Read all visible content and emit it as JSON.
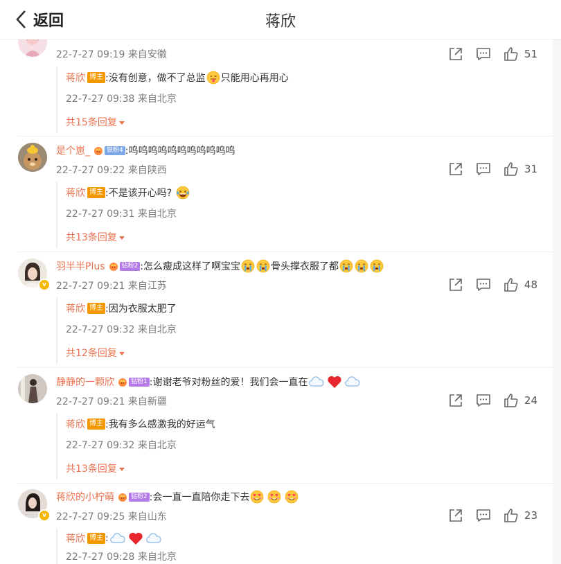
{
  "header": {
    "back_label": "返回",
    "title": "蒋欣"
  },
  "comments": [
    {
      "username": "",
      "text": "",
      "date": "22-7-27 09:19",
      "location": "来自安徽",
      "likes": "51",
      "reply": {
        "author": "蒋欣",
        "badge": "博主",
        "text_before": ":没有创意，做不了总监",
        "emoji": "tongue-face-icon",
        "text_after": "只能用心再用心",
        "date": "22-7-27 09:38",
        "location": "来自北京"
      },
      "more_replies": "共15条回复"
    },
    {
      "username": "是个崽_",
      "fan_badge": "铁粉4",
      "text": ":呜呜呜呜呜呜呜呜呜呜呜",
      "date": "22-7-27 09:22",
      "location": "来自陕西",
      "likes": "31",
      "reply": {
        "author": "蒋欣",
        "badge": "博主",
        "text": ":不是该开心吗?",
        "emoji": "laugh-tears-icon",
        "date": "22-7-27 09:31",
        "location": "来自北京"
      },
      "more_replies": "共13条回复"
    },
    {
      "username": "羽半半Plus",
      "fan_badge": "钻粉2",
      "text_before": ":怎么瘦成这样了啊宝宝",
      "text_after": "骨头撑衣服了都",
      "date": "22-7-27 09:21",
      "location": "来自江苏",
      "likes": "48",
      "reply": {
        "author": "蒋欣",
        "badge": "博主",
        "text": ":因为衣服太肥了",
        "date": "22-7-27 09:32",
        "location": "来自北京"
      },
      "more_replies": "共12条回复"
    },
    {
      "username": "静静的一颗欣",
      "fan_badge": "钻粉1",
      "text": ":谢谢老爷对粉丝的爱！我们会一直在",
      "date": "22-7-27 09:21",
      "location": "来自新疆",
      "likes": "24",
      "reply": {
        "author": "蒋欣",
        "badge": "博主",
        "text": ":我有多么感激我的好运气",
        "date": "22-7-27 09:32",
        "location": "来自北京"
      },
      "more_replies": "共13条回复"
    },
    {
      "username": "蒋欣的小柠萌",
      "fan_badge": "钻粉2",
      "text": ":会一直一直陪你走下去",
      "date": "22-7-27 09:25",
      "location": "来自山东",
      "likes": "23",
      "reply": {
        "author": "蒋欣",
        "badge": "博主",
        "text": ":",
        "date": "22-7-27 09:28",
        "location": "来自北京"
      }
    }
  ],
  "icons": {
    "share": "share-icon",
    "comment": "comment-icon",
    "like": "thumbs-up-icon",
    "crown": "crown-icon",
    "cloud": "cloud-icon",
    "heart": "red-heart-icon",
    "cry": "crying-face-icon",
    "love": "heart-eyes-face-icon"
  },
  "colors": {
    "username": "#eb7350",
    "blogger_badge": "#f39800",
    "meta": "#7a7a7a"
  }
}
